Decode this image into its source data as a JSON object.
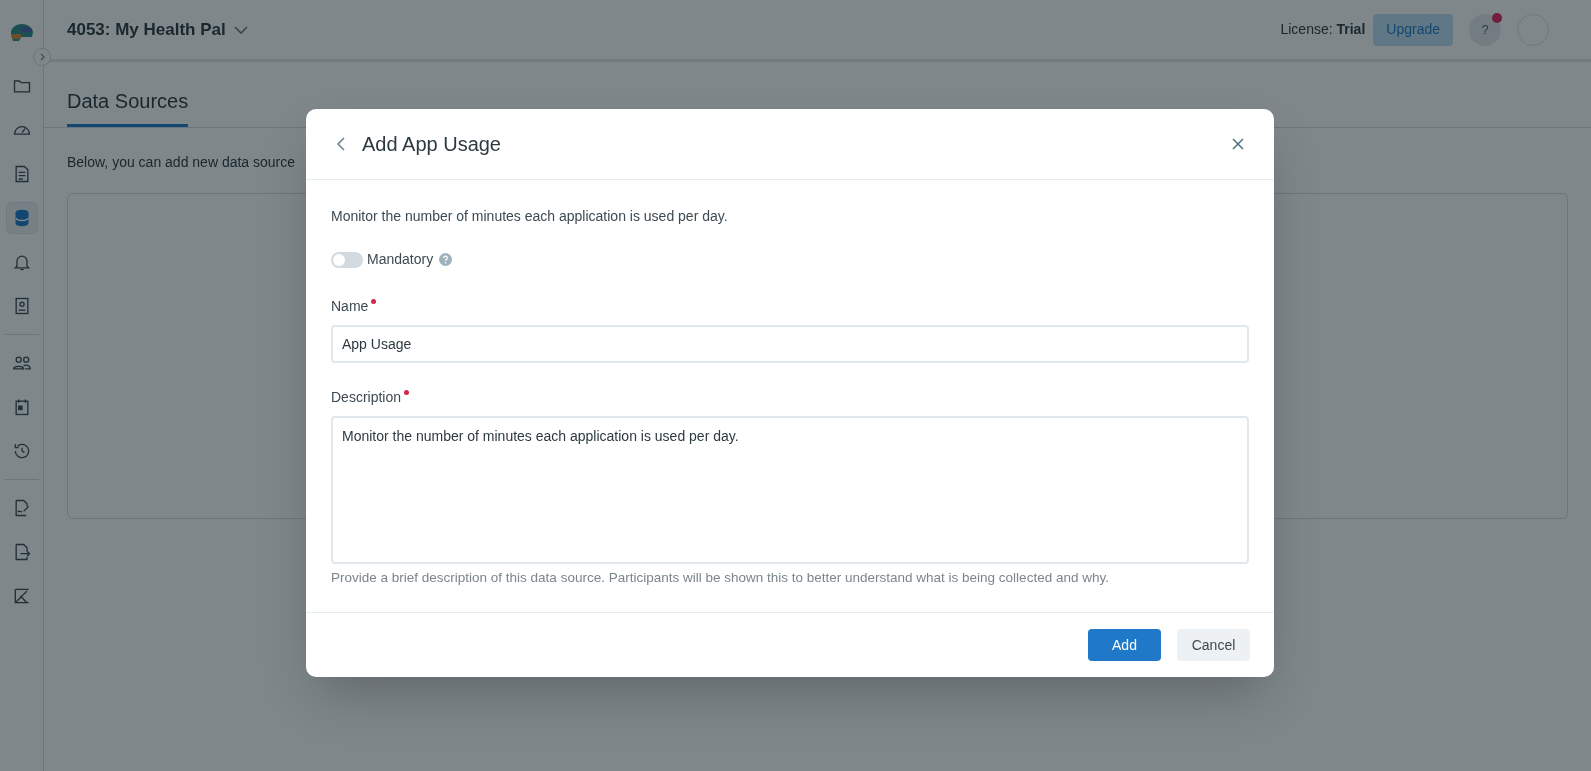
{
  "header": {
    "project_title": "4053: My Health Pal",
    "license": "License: **Trial**",
    "upgrade_button": "Upgrade",
    "help_button": {
      "label": "?",
      "notification": true
    }
  },
  "sidebar": {
    "items": [
      {
        "kind": "folder",
        "selected": false
      },
      {
        "kind": "gauge",
        "selected": false
      },
      {
        "kind": "document",
        "selected": false
      },
      {
        "kind": "database",
        "selected": true
      },
      {
        "kind": "bell",
        "selected": false
      },
      {
        "kind": "contact",
        "selected": false
      },
      {
        "kind": "divider"
      },
      {
        "kind": "people",
        "selected": false
      },
      {
        "kind": "calendar",
        "selected": false
      },
      {
        "kind": "history",
        "selected": false
      },
      {
        "kind": "divider"
      },
      {
        "kind": "signature",
        "selected": false
      },
      {
        "kind": "export",
        "selected": false
      },
      {
        "kind": "chart",
        "selected": false
      }
    ]
  },
  "tabs": [
    {
      "label": "Data Sources",
      "selected": true
    }
  ],
  "intro": "Below, you can add new data source",
  "dialog": {
    "title": "Add App Usage",
    "description": "Monitor the number of minutes each application is used per day.",
    "mandatory": {
      "label": "Mandatory",
      "on": false
    },
    "fields": [
      {
        "kind": "input",
        "label": "Name",
        "required": true,
        "value": "App Usage"
      },
      {
        "kind": "textarea",
        "label": "Description",
        "required": true,
        "value": "Monitor the number of minutes each application is used per day.",
        "help": "Provide a brief description of this data source. Participants will be shown this to better understand what is being collected and why."
      }
    ],
    "buttons": [
      {
        "kind": "primary",
        "label": "Add"
      },
      {
        "kind": "secondary",
        "label": "Cancel"
      }
    ]
  }
}
